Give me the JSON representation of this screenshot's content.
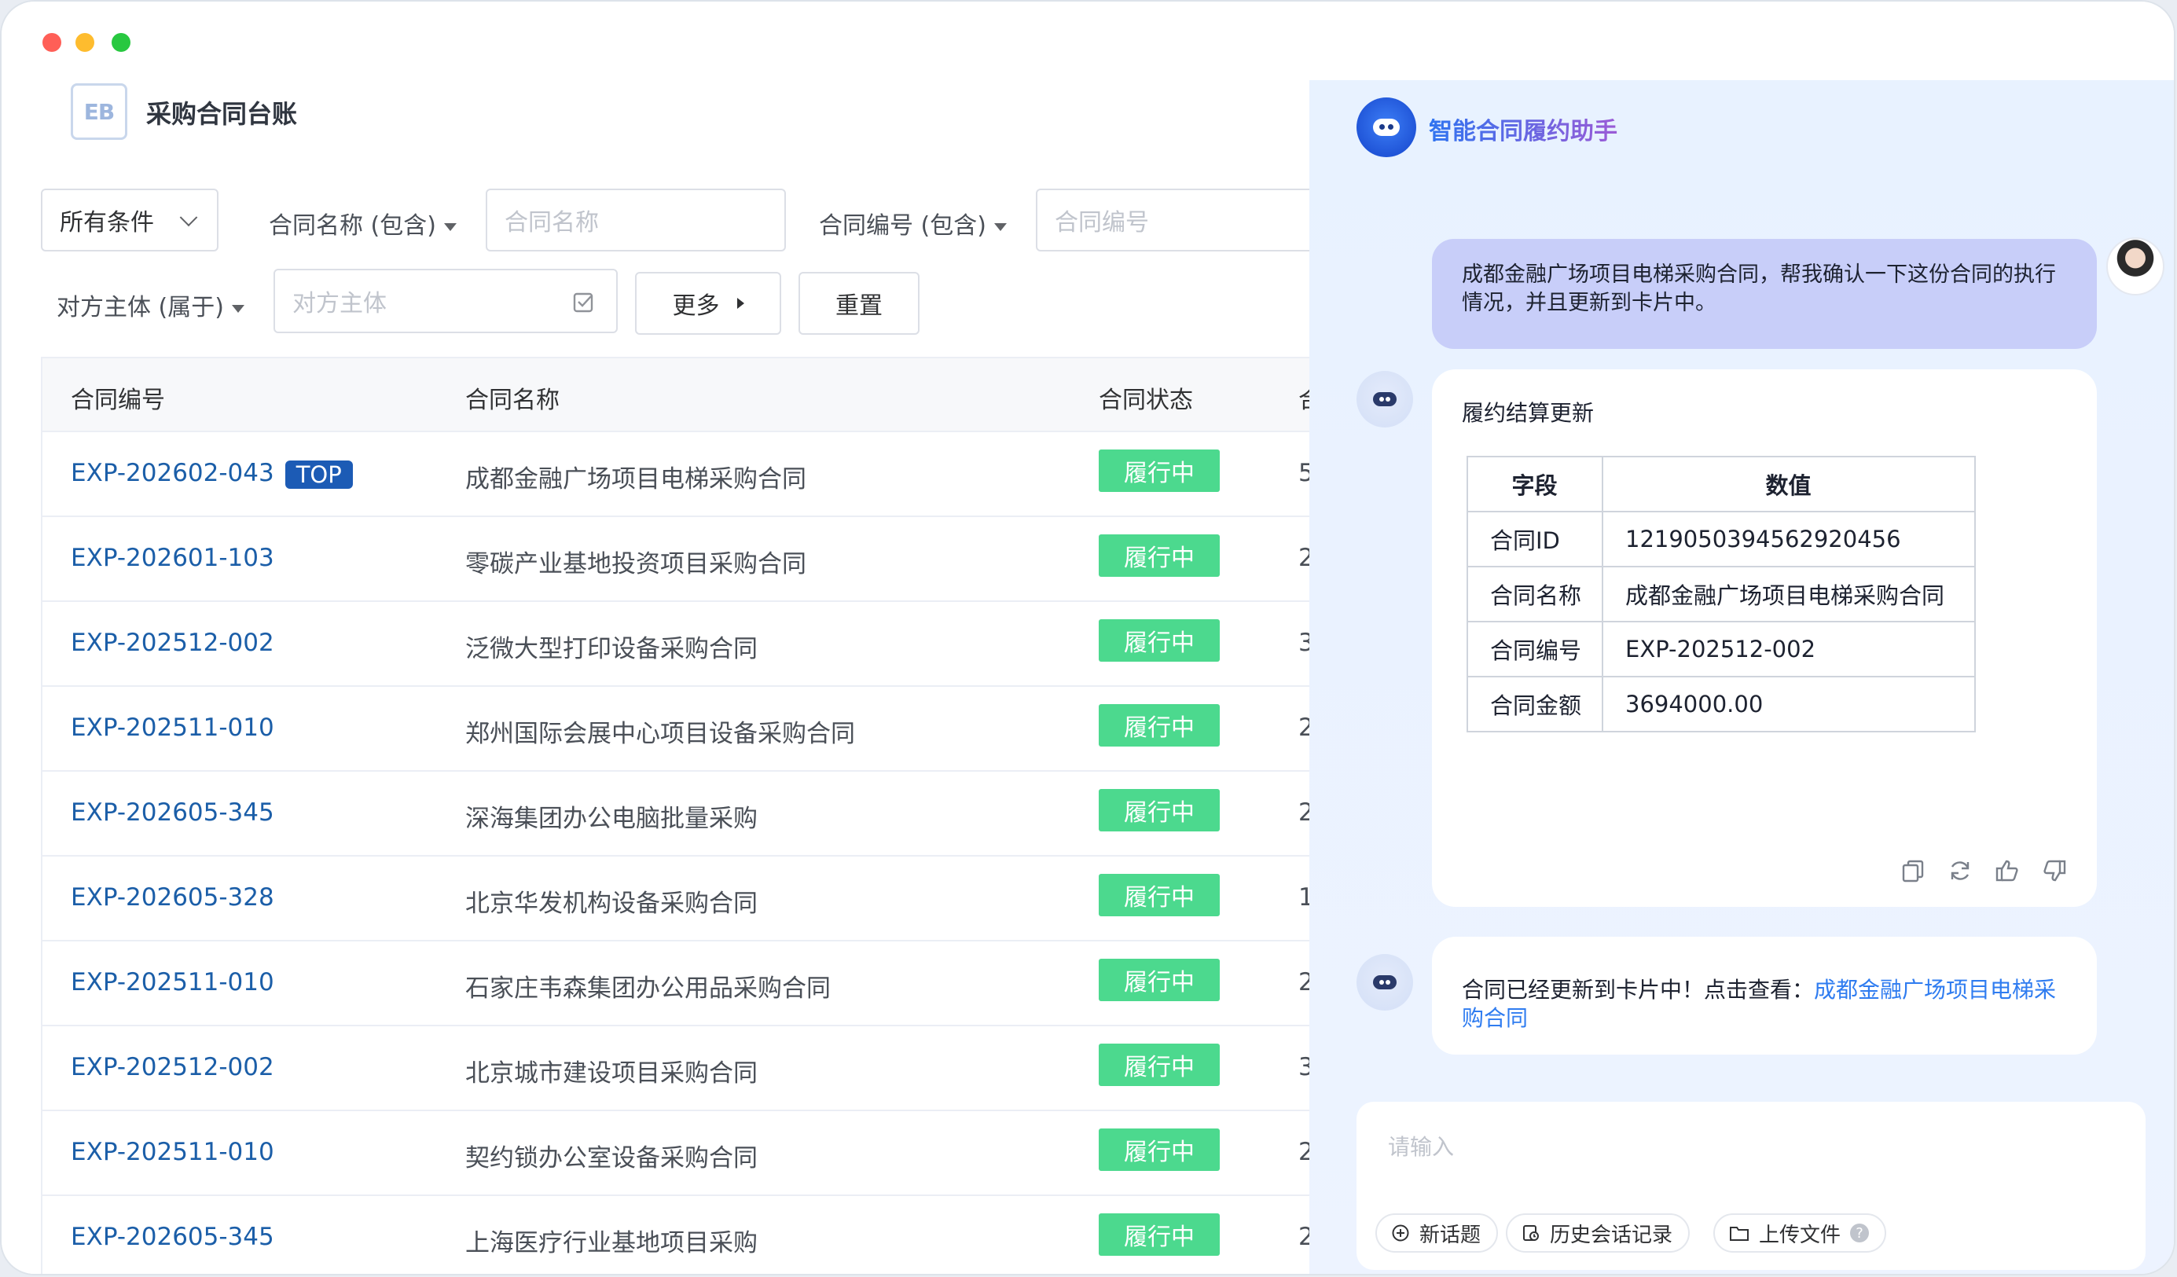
{
  "app": {
    "logo_text": "EB",
    "page_title": "采购合同台账"
  },
  "filters": {
    "condition_select": "所有条件",
    "contract_name_label": "合同名称 (包含)",
    "contract_name_placeholder": "合同名称",
    "contract_code_label": "合同编号 (包含)",
    "contract_code_placeholder": "合同编号",
    "counterparty_label": "对方主体 (属于)",
    "counterparty_placeholder": "对方主体",
    "more_label": "更多",
    "reset_label": "重置"
  },
  "table": {
    "headers": [
      "合同编号",
      "合同名称",
      "合同状态",
      "合"
    ],
    "rows": [
      {
        "code": "EXP-202602-043",
        "badge": "TOP",
        "name": "成都金融广场项目电梯采购合同",
        "status": "履行中",
        "col4": "5"
      },
      {
        "code": "EXP-202601-103",
        "badge": "",
        "name": "零碳产业基地投资项目采购合同",
        "status": "履行中",
        "col4": "2"
      },
      {
        "code": "EXP-202512-002",
        "badge": "",
        "name": "泛微大型打印设备采购合同",
        "status": "履行中",
        "col4": "3"
      },
      {
        "code": "EXP-202511-010",
        "badge": "",
        "name": "郑州国际会展中心项目设备采购合同",
        "status": "履行中",
        "col4": "2"
      },
      {
        "code": "EXP-202605-345",
        "badge": "",
        "name": "深海集团办公电脑批量采购",
        "status": "履行中",
        "col4": "2"
      },
      {
        "code": "EXP-202605-328",
        "badge": "",
        "name": "北京华发机构设备采购合同",
        "status": "履行中",
        "col4": "1"
      },
      {
        "code": "EXP-202511-010",
        "badge": "",
        "name": "石家庄韦森集团办公用品采购合同",
        "status": "履行中",
        "col4": "2"
      },
      {
        "code": "EXP-202512-002",
        "badge": "",
        "name": "北京城市建设项目采购合同",
        "status": "履行中",
        "col4": "3"
      },
      {
        "code": "EXP-202511-010",
        "badge": "",
        "name": "契约锁办公室设备采购合同",
        "status": "履行中",
        "col4": "2"
      },
      {
        "code": "EXP-202605-345",
        "badge": "",
        "name": "上海医疗行业基地项目采购",
        "status": "履行中",
        "col4": "2"
      }
    ]
  },
  "assistant": {
    "title": "智能合同履约助手",
    "user_message": "成都金融广场项目电梯采购合同，帮我确认一下这份合同的执行情况，并且更新到卡片中。",
    "card_title": "履约结算更新",
    "kv_headers": [
      "字段",
      "数值"
    ],
    "kv_rows": [
      {
        "field": "合同ID",
        "value": "1219050394562920456"
      },
      {
        "field": "合同名称",
        "value": "成都金融广场项目电梯采购合同"
      },
      {
        "field": "合同编号",
        "value": "EXP-202512-002"
      },
      {
        "field": "合同金额",
        "value": "3694000.00"
      }
    ],
    "reply_prefix": "合同已经更新到卡片中！点击查看：",
    "reply_link": "成都金融广场项目电梯采购合同",
    "input_placeholder": "请输入",
    "chips": [
      "新话题",
      "历史会话记录",
      "上传文件"
    ],
    "help_mark": "?"
  },
  "colors": {
    "status_green": "#4cd98e",
    "link_blue": "#1b5ea8",
    "badge_blue": "#1c5bb5",
    "user_bubble": "#c8cef9"
  }
}
